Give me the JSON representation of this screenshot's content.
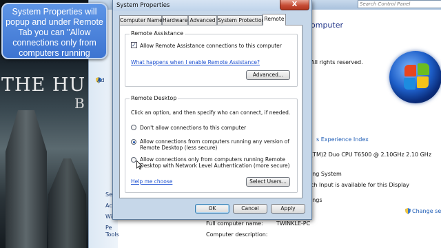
{
  "tutorial": {
    "callout": "System Properties will popup and under Remote Tab you can \"Allow connections only from computers running"
  },
  "wallpaper": {
    "title": "THE HU",
    "subtitle": "B"
  },
  "control_panel": {
    "search_placeholder": "Search Control Panel",
    "heading_fragment": "omputer",
    "copyright_fragment": "All rights reserved.",
    "wei_link": "s Experience Index",
    "cpu_fragment": "(TM)2 Duo CPU    T6500  @ 2.10GHz   2.10 GHz",
    "pen_line1": "ing System",
    "pen_line2": "ch Input is available for this Display",
    "settings_fragment": "ings",
    "change_settings": "Change setti",
    "side_links": [
      "Ad",
      "Se",
      "Ac",
      "Wi",
      "Pe",
      "Tools"
    ],
    "full_name_label": "Full computer name:",
    "full_name_value": "TWINKLE-PC",
    "description_label": "Computer description:"
  },
  "dialog": {
    "title": "System Properties",
    "close_glyph": "X",
    "tabs": [
      "Computer Name",
      "Hardware",
      "Advanced",
      "System Protection",
      "Remote"
    ],
    "active_tab": "Remote",
    "remote_assistance": {
      "group_title": "Remote Assistance",
      "checkbox_label": "Allow Remote Assistance connections to this computer",
      "checked": true,
      "help_link": "What happens when I enable Remote Assistance?",
      "advanced_button": "Advanced..."
    },
    "remote_desktop": {
      "group_title": "Remote Desktop",
      "instruction": "Click an option, and then specify who can connect, if needed.",
      "options": [
        {
          "line1": "Don't allow connections to this computer",
          "line2": "",
          "selected": false
        },
        {
          "line1": "Allow connections from computers running any version of",
          "line2": "Remote Desktop (less secure)",
          "selected": true
        },
        {
          "line1": "Allow connections only from computers running Remote",
          "line2": "Desktop with Network Level Authentication (more secure)",
          "selected": false
        }
      ],
      "help_link": "Help me choose",
      "select_users_button": "Select Users..."
    },
    "buttons": {
      "ok": "OK",
      "cancel": "Cancel",
      "apply": "Apply"
    }
  }
}
